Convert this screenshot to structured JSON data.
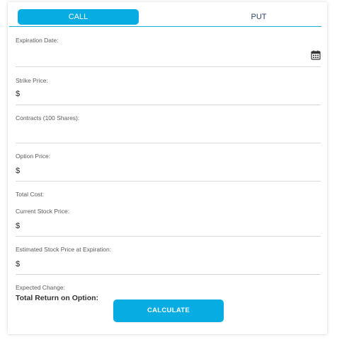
{
  "tabs": {
    "call_label": "CALL",
    "put_label": "PUT",
    "active": "CALL"
  },
  "form": {
    "expiration_label": "Expiration Date:",
    "expiration_value": "",
    "strike_label": "Strike Price:",
    "strike_value": "$",
    "contracts_label": "Contracts (100 Shares):",
    "contracts_value": "",
    "option_price_label": "Option Price:",
    "option_price_value": "$",
    "total_cost_label": "Total Cost:",
    "current_stock_label": "Current Stock Price:",
    "current_stock_value": "$",
    "estimated_label": "Estimated Stock Price at Expiration:",
    "estimated_value": "$",
    "expected_change_label": "Expected Change:",
    "total_return_label": "Total Return on Option:"
  },
  "actions": {
    "calculate_label": "CALCULATE"
  },
  "icons": {
    "expiration": "calendar-icon"
  },
  "colors": {
    "accent": "#06ace2",
    "tab_text_inactive": "#2e4566",
    "divider": "#d9d9d9",
    "label": "#5b5b5b"
  }
}
